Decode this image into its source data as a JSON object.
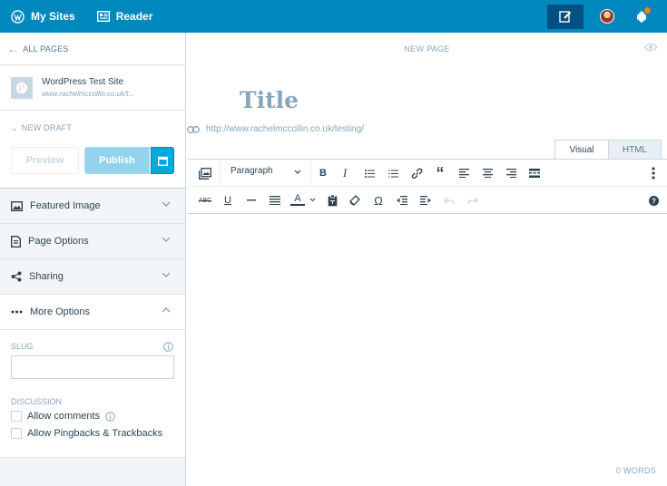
{
  "masterbar": {
    "my_sites": "My Sites",
    "reader": "Reader"
  },
  "sidebar": {
    "back_label": "ALL PAGES",
    "site_name": "WordPress Test Site",
    "site_url": "www.rachelmccollin.co.uk/t...",
    "status": "NEW DRAFT",
    "preview_label": "Preview",
    "publish_label": "Publish",
    "accordions": [
      {
        "label": "Featured Image"
      },
      {
        "label": "Page Options"
      },
      {
        "label": "Sharing"
      },
      {
        "label": "More Options"
      }
    ],
    "more_options": {
      "slug_label": "SLUG",
      "slug_value": "",
      "discussion_label": "DISCUSSION",
      "allow_comments": "Allow comments",
      "allow_pingbacks": "Allow Pingbacks & Trackbacks"
    }
  },
  "editor": {
    "page_label": "NEW PAGE",
    "title_placeholder": "Title",
    "permalink": "http://www.rachelmccollin.co.uk/testing/",
    "tabs": [
      "Visual",
      "HTML"
    ],
    "format_select": "Paragraph",
    "word_count": "0 WORDS"
  },
  "colors": {
    "masterbar": "#0087be",
    "publish_disabled": "#93d3ee",
    "schedule": "#00aadc",
    "muted_text": "#87a6bc"
  }
}
